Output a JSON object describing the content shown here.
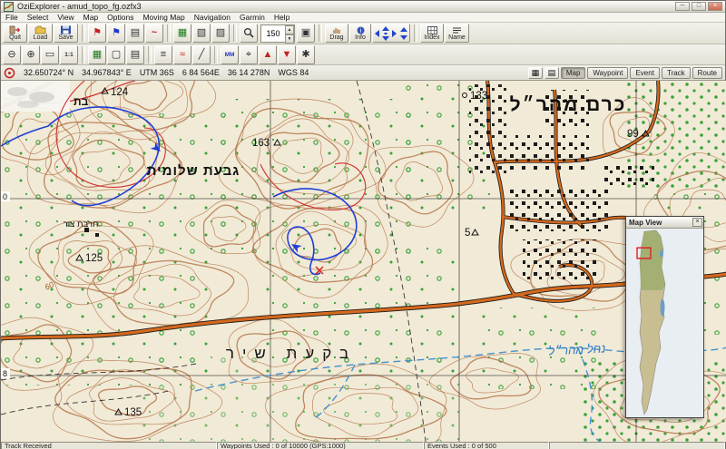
{
  "window": {
    "title": "OziExplorer - amud_topo_fg.ozfx3"
  },
  "menubar": {
    "items": [
      "File",
      "Select",
      "View",
      "Map",
      "Options",
      "Moving Map",
      "Navigation",
      "Garmin",
      "Help"
    ]
  },
  "toolbar": {
    "quit": "Quit",
    "load": "Load",
    "save": "Save",
    "zoom_value": "150",
    "drag": "Drag",
    "info": "Info",
    "index": "Index",
    "name": "Name"
  },
  "icons": {
    "minimize": "─",
    "maximize": "□",
    "close": "×",
    "wp_flag": "⚑",
    "event_flag": "⚑",
    "note": "▤",
    "track_wave": "~",
    "map_a": "▦",
    "map_b": "▧",
    "map_c": "▨",
    "lock": "▣",
    "zoom_in": "⊕",
    "zoom_out": "⊖",
    "zoom_box": "▭",
    "one_one": "1:1",
    "page": "▢",
    "list": "≡",
    "wave": "≈",
    "ruler": "╱",
    "mm": "MM",
    "target": "⌖",
    "up": "▲",
    "down": "▼",
    "star": "✱",
    "grid1": "▦",
    "grid2": "▤",
    "spin_up": "▲",
    "spin_down": "▼",
    "panel_close": "×"
  },
  "coordbar": {
    "latitude": "32.650724° N",
    "longitude": "34.967843° E",
    "zone": "UTM 36S",
    "easting": "6 84 564E",
    "northing": "36 14 278N",
    "datum": "WGS 84",
    "mode_buttons": [
      "Map",
      "Waypoint",
      "Event",
      "Track",
      "Route"
    ]
  },
  "map": {
    "labels": {
      "village": "כרם מהר״ל",
      "hill": "גבעת שלומית",
      "ruin": "חרבת צור",
      "valley": "בקעת שיר",
      "stream": "נחל מהר״ל",
      "partial": "בת"
    },
    "heights": {
      "h124": "124",
      "h163": "163",
      "h133": "133",
      "h99": "99",
      "h125": "125",
      "h135": "135",
      "h5": "5",
      "h60": "60"
    },
    "grid_labels": {
      "row0": "0",
      "row8": "8"
    }
  },
  "mapview_panel": {
    "title": "Map View"
  },
  "statusbar": {
    "track": "Track Received",
    "waypoints": "Waypoints Used : 0 of 10000  (GPS:1000)",
    "events": "Events Used : 0 of 500"
  }
}
